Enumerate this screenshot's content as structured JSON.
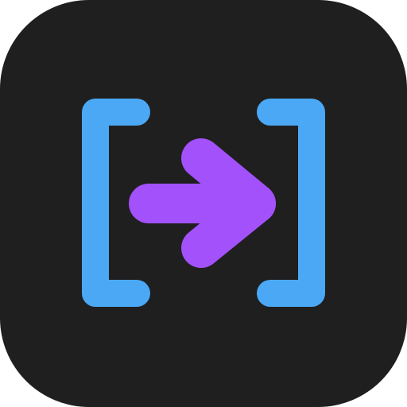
{
  "app_icon": {
    "tile_color": "#1f1f1f",
    "bracket_color": "#4ba8f5",
    "arrow_color": "#a351fb",
    "icons": {
      "tile": "rounded-square-tile",
      "left_bracket": "left-bracket-icon",
      "right_bracket": "right-bracket-icon",
      "arrow": "arrow-right-icon"
    }
  }
}
